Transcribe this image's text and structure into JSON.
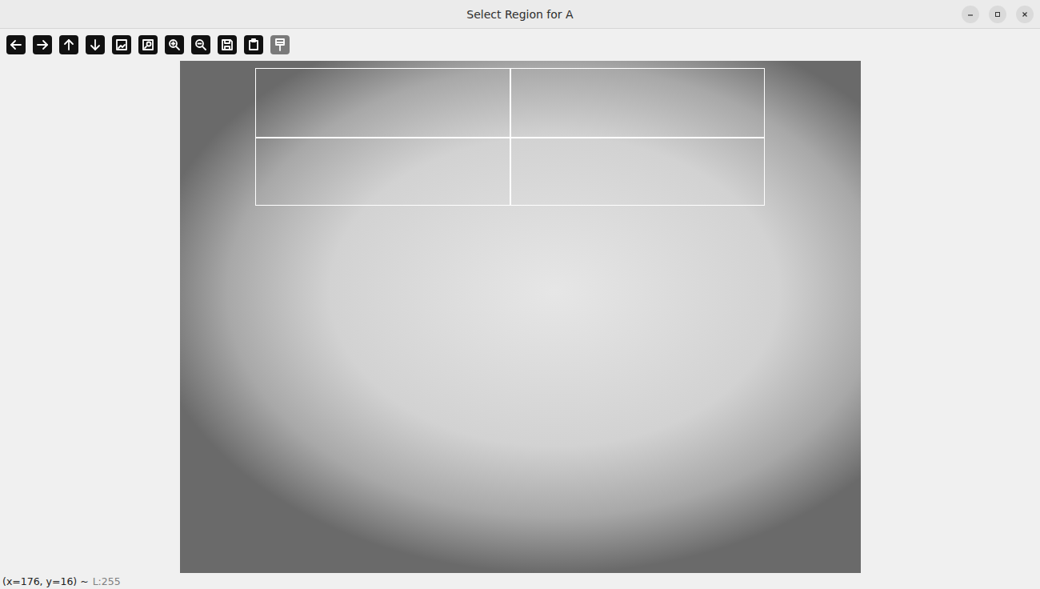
{
  "window": {
    "title": "Select Region for A"
  },
  "toolbar": {
    "buttons": [
      {
        "disabled": false
      },
      {
        "disabled": false
      },
      {
        "disabled": false
      },
      {
        "disabled": false
      },
      {
        "disabled": false
      },
      {
        "disabled": false
      },
      {
        "disabled": false
      },
      {
        "disabled": false
      },
      {
        "disabled": false
      },
      {
        "disabled": false
      },
      {
        "disabled": true
      }
    ]
  },
  "status_bar": {
    "position": "(x=176, y=16) ~",
    "value": "L:255"
  }
}
